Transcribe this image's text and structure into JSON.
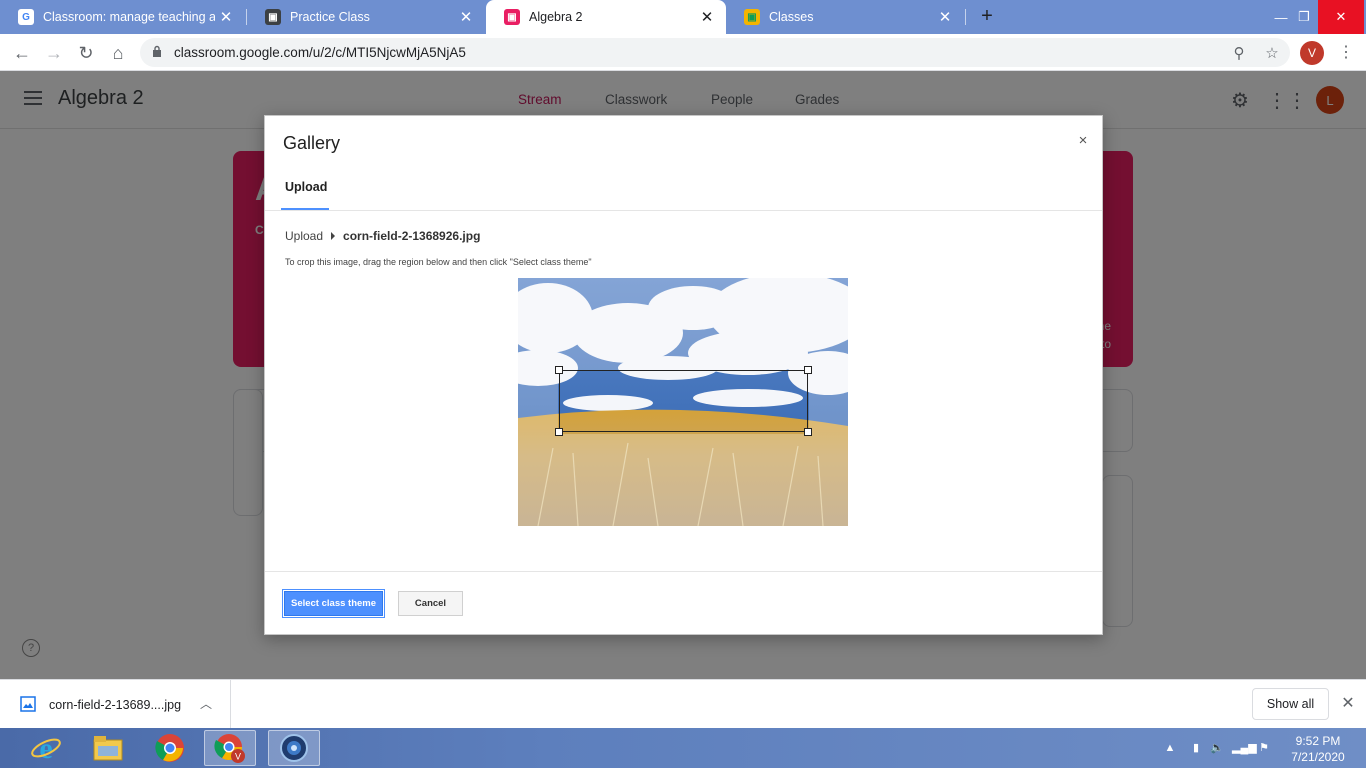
{
  "browser": {
    "tabs": [
      {
        "title": "Classroom: manage teaching and",
        "favicon": "google-g-icon"
      },
      {
        "title": "Practice Class",
        "favicon": "classroom-icon"
      },
      {
        "title": "Algebra 2",
        "favicon": "classroom-icon",
        "active": true
      },
      {
        "title": "Classes",
        "favicon": "classroom-icon"
      }
    ],
    "url": "classroom.google.com/u/2/c/MTI5NjcwMjA5NjA5",
    "profile_initial": "V"
  },
  "classroom": {
    "class_name": "Algebra 2",
    "nav_tabs": [
      "Stream",
      "Classwork",
      "People",
      "Grades"
    ],
    "active_tab": "Stream",
    "account_initial": "L",
    "accent_color": "#c2185b",
    "banner_color": "#e91e63",
    "help_glyph": "?"
  },
  "gallery_dialog": {
    "title": "Gallery",
    "tab_label": "Upload",
    "breadcrumb_root": "Upload",
    "file_name": "corn-field-2-1368926.jpg",
    "hint": "To crop this image, drag the region below and then click \"Select class theme\"",
    "primary_button": "Select class theme",
    "secondary_button": "Cancel",
    "close_glyph": "×"
  },
  "downloads": {
    "file_name": "corn-field-2-13689....jpg",
    "show_all": "Show all"
  },
  "taskbar": {
    "time": "9:52 PM",
    "date": "7/21/2020"
  }
}
